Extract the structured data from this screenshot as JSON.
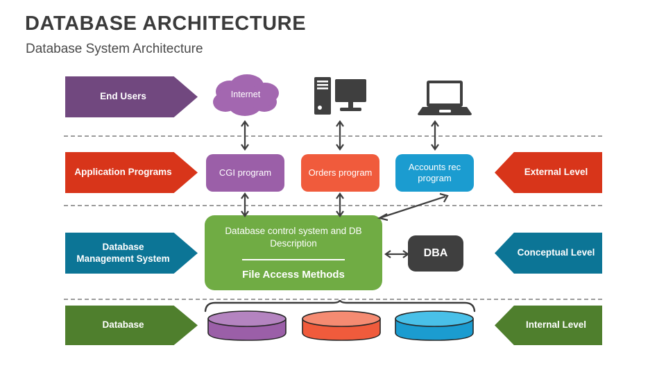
{
  "header": {
    "title": "DATABASE ARCHITECTURE",
    "subtitle": "Database System Architecture"
  },
  "left_labels": [
    {
      "name": "end-users",
      "text": "End Users",
      "color": "#71487f"
    },
    {
      "name": "application-programs",
      "text": "Application Programs",
      "color": "#d8351a"
    },
    {
      "name": "database-management-system",
      "text": "Database\nManagement System",
      "color": "#0c7596"
    },
    {
      "name": "database",
      "text": "Database",
      "color": "#4f7f2d"
    }
  ],
  "right_labels": [
    {
      "name": "external-level",
      "text": "External Level",
      "color": "#d8351a"
    },
    {
      "name": "conceptual-level",
      "text": "Conceptual Level",
      "color": "#0c7596"
    },
    {
      "name": "internal-level",
      "text": "Internal Level",
      "color": "#4f7f2d"
    }
  ],
  "top_nodes": {
    "cloud_label": "Internet",
    "cloud_color": "#a367b0",
    "desktop_icon": "desktop-computer-icon",
    "laptop_icon": "laptop-computer-icon",
    "icon_color": "#3f3f3f"
  },
  "programs": [
    {
      "name": "cgi-program",
      "text": "CGI program",
      "color": "#9b5fa8"
    },
    {
      "name": "orders-program",
      "text": "Orders program",
      "color": "#f05b3c"
    },
    {
      "name": "accounts-rec-program",
      "text": "Accounts rec program",
      "color": "#1b9cd0"
    }
  ],
  "dbms": {
    "top_text": "Database control system and DB Description",
    "bottom_text": "File Access Methods",
    "color": "#70ac44"
  },
  "dba": {
    "text": "DBA",
    "color": "#3f3f3f"
  },
  "databases": [
    {
      "name": "database-cylinder-purple",
      "color": "#9b5fa8",
      "top_color": "#b484c0"
    },
    {
      "name": "database-cylinder-orange",
      "color": "#f05b3c",
      "top_color": "#f58b72"
    },
    {
      "name": "database-cylinder-blue",
      "color": "#1b9cd0",
      "top_color": "#49c0e8"
    }
  ],
  "connectors": {
    "dashed_color": "#9b9b9b",
    "arrow_color": "#3f3f3f",
    "dashed_line_count": 3,
    "vertical_arrow_count": 5,
    "diagonal_arrow_count": 1,
    "brace_count": 1
  }
}
